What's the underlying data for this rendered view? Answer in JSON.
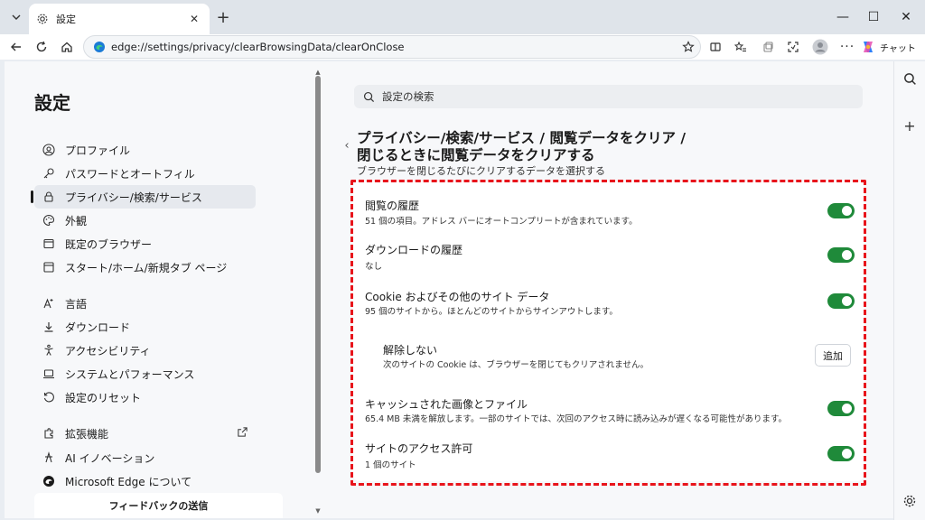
{
  "tab": {
    "title": "設定",
    "icon": "gear-icon"
  },
  "window": {
    "minimize": "—",
    "maximize": "☐",
    "close": "✕"
  },
  "toolbar": {
    "url": "edge://settings/privacy/clearBrowsingData/clearOnClose",
    "copilot_label": "チャット"
  },
  "sidebar": {
    "title": "設定",
    "items": [
      {
        "label": "プロファイル",
        "icon": "profile-icon"
      },
      {
        "label": "パスワードとオートフィル",
        "icon": "key-icon"
      },
      {
        "label": "プライバシー/検索/サービス",
        "icon": "lock-icon",
        "active": true
      },
      {
        "label": "外観",
        "icon": "palette-icon"
      },
      {
        "label": "既定のブラウザー",
        "icon": "browser-icon"
      },
      {
        "label": "スタート/ホーム/新規タブ ページ",
        "icon": "home-page-icon"
      },
      {
        "label": "言語",
        "icon": "language-icon"
      },
      {
        "label": "ダウンロード",
        "icon": "download-icon"
      },
      {
        "label": "アクセシビリティ",
        "icon": "accessibility-icon"
      },
      {
        "label": "システムとパフォーマンス",
        "icon": "laptop-icon"
      },
      {
        "label": "設定のリセット",
        "icon": "reset-icon"
      },
      {
        "label": "拡張機能",
        "icon": "extensions-icon"
      },
      {
        "label": "AI イノベーション",
        "icon": "ai-icon"
      },
      {
        "label": "Microsoft Edge について",
        "icon": "edge-logo-icon"
      }
    ],
    "feedback": "フィードバックの送信"
  },
  "search": {
    "placeholder": "設定の検索"
  },
  "header": {
    "breadcrumb_line1": "プライバシー/検索/サービス / 閲覧データをクリア /",
    "breadcrumb_line2": "閉じるときに閲覧データをクリアする",
    "subtitle": "ブラウザーを閉じるたびにクリアするデータを選択する"
  },
  "rows": [
    {
      "title": "閲覧の履歴",
      "desc": "51 個の項目。アドレス バーにオートコンプリートが含まれています。",
      "on": true
    },
    {
      "title": "ダウンロードの履歴",
      "desc": "なし",
      "on": true
    },
    {
      "title": "Cookie およびその他のサイト データ",
      "desc": "95 個のサイトから。ほとんどのサイトからサインアウトします。",
      "on": true
    },
    {
      "title": "キャッシュされた画像とファイル",
      "desc": "65.4 MB 未満を解放します。一部のサイトでは、次回のアクセス時に読み込みが遅くなる可能性があります。",
      "on": true
    },
    {
      "title": "サイトのアクセス許可",
      "desc": "1 個のサイト",
      "on": true
    }
  ],
  "exceptions": {
    "title": "解除しない",
    "desc": "次のサイトの Cookie は、ブラウザーを閉じてもクリアされません。",
    "button": "追加"
  },
  "colors": {
    "toggle_on": "#1f8a3a",
    "highlight": "#e8141b"
  }
}
